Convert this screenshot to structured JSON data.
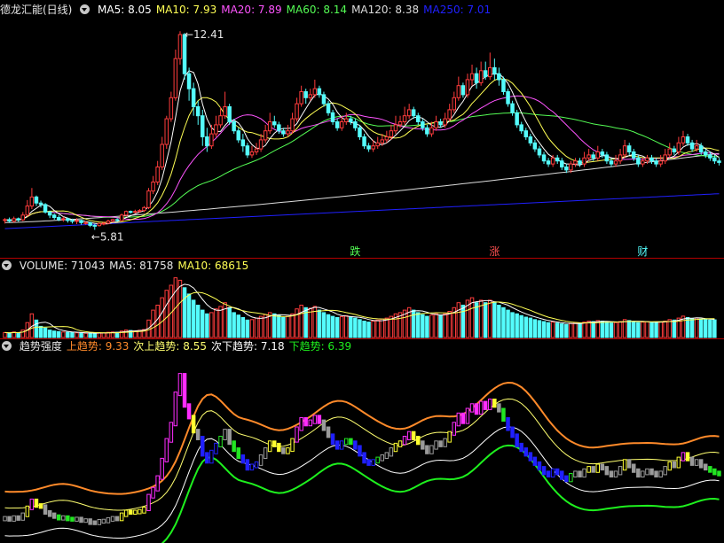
{
  "colors": {
    "up": "#ff3c3c",
    "down": "#54fcfc",
    "ma5": "#ffffff",
    "ma10": "#ffff54",
    "ma20": "#ff54ff",
    "ma60": "#54fc54",
    "ma120": "#dcdcdc",
    "ma250": "#2020ff",
    "sep": "#b40000",
    "trend_up": "#ff8a2a",
    "trend_up2": "#ffff70",
    "trend_down2": "#ffffff",
    "trend_down": "#1ef01e"
  },
  "price_panel": {
    "title": "德龙汇能(日线)",
    "legend": [
      {
        "label": "MA5: 8.05",
        "color": "#ffffff"
      },
      {
        "label": "MA10: 7.93",
        "color": "#ffff54"
      },
      {
        "label": "MA20: 7.89",
        "color": "#ff54ff"
      },
      {
        "label": "MA60: 8.14",
        "color": "#54fc54"
      },
      {
        "label": "MA120: 8.38",
        "color": "#dcdcdc"
      },
      {
        "label": "MA250: 7.01",
        "color": "#2020ff"
      }
    ],
    "high_label": "12.41",
    "low_label": "5.81",
    "event_markers": [
      {
        "text": "跌",
        "color": "#54fc54",
        "index": 78
      },
      {
        "text": "涨",
        "color": "#ff5050",
        "index": 109
      },
      {
        "text": "财",
        "color": "#54fcfc",
        "index": 142
      }
    ]
  },
  "volume_panel": {
    "legend": [
      {
        "label": "VOLUME: 71043",
        "color": "#e6e6e6"
      },
      {
        "label": "MA5: 81758",
        "color": "#e6e6e6"
      },
      {
        "label": "MA10: 68615",
        "color": "#ffff54"
      }
    ]
  },
  "trend_panel": {
    "legend": [
      {
        "label": "趋势强度",
        "color": "#e6e6e6"
      },
      {
        "label": "上趋势: 9.33",
        "color": "#ff8a2a"
      },
      {
        "label": "次上趋势: 8.55",
        "color": "#ffff70"
      },
      {
        "label": "次下趋势: 7.18",
        "color": "#ffffff"
      },
      {
        "label": "下趋势: 6.39",
        "color": "#1ef01e"
      }
    ]
  },
  "chart_data": [
    {
      "type": "candlestick",
      "title": "德龙汇能(日线)",
      "ylim": [
        5.5,
        12.8
      ],
      "candles": [
        [
          6.12,
          6.15,
          6.02,
          6.2
        ],
        [
          6.15,
          6.1,
          6.05,
          6.22
        ],
        [
          6.1,
          6.18,
          6.05,
          6.25
        ],
        [
          6.18,
          6.14,
          6.08,
          6.22
        ],
        [
          6.14,
          6.3,
          6.1,
          6.4
        ],
        [
          6.3,
          6.6,
          6.25,
          6.8
        ],
        [
          6.6,
          6.9,
          6.5,
          7.2
        ],
        [
          6.9,
          6.7,
          6.6,
          6.95
        ],
        [
          6.7,
          6.65,
          6.55,
          6.78
        ],
        [
          6.65,
          6.4,
          6.35,
          6.7
        ],
        [
          6.4,
          6.3,
          6.2,
          6.45
        ],
        [
          6.3,
          6.22,
          6.15,
          6.35
        ],
        [
          6.22,
          6.15,
          6.1,
          6.3
        ],
        [
          6.15,
          6.18,
          6.08,
          6.25
        ],
        [
          6.18,
          6.12,
          6.05,
          6.22
        ],
        [
          6.12,
          6.1,
          6.02,
          6.18
        ],
        [
          6.1,
          6.12,
          6.0,
          6.2
        ],
        [
          6.12,
          6.05,
          5.98,
          6.15
        ],
        [
          6.05,
          6.05,
          5.98,
          6.1
        ],
        [
          6.05,
          5.96,
          5.9,
          6.08
        ],
        [
          5.96,
          5.95,
          5.81,
          6.0
        ],
        [
          5.95,
          6.02,
          5.92,
          6.05
        ],
        [
          6.02,
          6.03,
          5.96,
          6.08
        ],
        [
          6.03,
          6.1,
          6.0,
          6.15
        ],
        [
          6.1,
          6.15,
          6.05,
          6.18
        ],
        [
          6.15,
          6.12,
          6.08,
          6.2
        ],
        [
          6.12,
          6.3,
          6.1,
          6.35
        ],
        [
          6.3,
          6.42,
          6.25,
          6.45
        ],
        [
          6.42,
          6.4,
          6.35,
          6.45
        ],
        [
          6.4,
          6.42,
          6.36,
          6.48
        ],
        [
          6.42,
          6.45,
          6.38,
          6.5
        ],
        [
          6.45,
          6.55,
          6.4,
          6.6
        ],
        [
          6.55,
          7.1,
          6.5,
          7.2
        ],
        [
          7.1,
          7.4,
          7.0,
          7.6
        ],
        [
          7.4,
          7.9,
          7.3,
          8.1
        ],
        [
          7.9,
          8.65,
          7.8,
          8.9
        ],
        [
          8.65,
          9.5,
          8.5,
          9.6
        ],
        [
          9.5,
          10.2,
          9.4,
          10.4
        ],
        [
          10.2,
          11.5,
          10.1,
          11.8
        ],
        [
          11.5,
          12.3,
          11.3,
          12.41
        ],
        [
          12.3,
          11.0,
          10.8,
          12.35
        ],
        [
          11.0,
          10.5,
          10.1,
          11.2
        ],
        [
          10.5,
          9.9,
          9.6,
          10.7
        ],
        [
          9.9,
          9.6,
          9.3,
          10.1
        ],
        [
          9.6,
          8.9,
          8.6,
          9.8
        ],
        [
          8.9,
          8.6,
          8.4,
          9.2
        ],
        [
          8.6,
          9.0,
          8.5,
          9.3
        ],
        [
          9.0,
          9.3,
          8.9,
          9.6
        ],
        [
          9.3,
          9.6,
          9.2,
          9.9
        ],
        [
          9.6,
          9.9,
          9.5,
          10.4
        ],
        [
          9.9,
          9.4,
          9.3,
          10.0
        ],
        [
          9.4,
          9.1,
          9.0,
          9.5
        ],
        [
          9.1,
          8.8,
          8.7,
          9.2
        ],
        [
          8.8,
          8.6,
          8.4,
          9.0
        ],
        [
          8.6,
          8.3,
          8.2,
          8.7
        ],
        [
          8.3,
          8.4,
          8.2,
          8.6
        ],
        [
          8.4,
          8.5,
          8.3,
          8.7
        ],
        [
          8.5,
          8.8,
          8.4,
          9.0
        ],
        [
          8.8,
          9.1,
          8.7,
          9.3
        ],
        [
          9.1,
          9.4,
          9.0,
          9.7
        ],
        [
          9.4,
          9.3,
          9.2,
          9.6
        ],
        [
          9.3,
          9.1,
          9.0,
          9.4
        ],
        [
          9.1,
          9.0,
          8.9,
          9.2
        ],
        [
          9.0,
          9.1,
          8.9,
          9.3
        ],
        [
          9.1,
          9.5,
          9.0,
          9.7
        ],
        [
          9.5,
          10.0,
          9.4,
          10.2
        ],
        [
          10.0,
          10.4,
          9.9,
          10.6
        ],
        [
          10.4,
          10.2,
          10.0,
          10.5
        ],
        [
          10.2,
          10.3,
          10.1,
          10.5
        ],
        [
          10.3,
          10.5,
          10.2,
          10.8
        ],
        [
          10.5,
          10.3,
          10.2,
          10.6
        ],
        [
          10.3,
          10.0,
          9.9,
          10.4
        ],
        [
          10.0,
          9.7,
          9.6,
          10.1
        ],
        [
          9.7,
          9.4,
          9.3,
          9.8
        ],
        [
          9.4,
          9.2,
          9.1,
          9.5
        ],
        [
          9.2,
          9.4,
          9.1,
          9.6
        ],
        [
          9.4,
          9.5,
          9.3,
          9.7
        ],
        [
          9.5,
          9.4,
          9.3,
          9.6
        ],
        [
          9.4,
          9.2,
          9.1,
          9.5
        ],
        [
          9.2,
          8.9,
          8.8,
          9.3
        ],
        [
          8.9,
          8.6,
          8.5,
          9.0
        ],
        [
          8.6,
          8.5,
          8.4,
          8.7
        ],
        [
          8.5,
          8.6,
          8.4,
          8.8
        ],
        [
          8.6,
          8.7,
          8.5,
          8.9
        ],
        [
          8.7,
          8.8,
          8.6,
          9.0
        ],
        [
          8.8,
          8.9,
          8.7,
          9.1
        ],
        [
          8.9,
          9.1,
          8.8,
          9.3
        ],
        [
          9.1,
          9.3,
          9.0,
          9.6
        ],
        [
          9.3,
          9.4,
          9.2,
          9.6
        ],
        [
          9.4,
          9.6,
          9.3,
          9.9
        ],
        [
          9.6,
          9.8,
          9.5,
          10.0
        ],
        [
          9.8,
          9.6,
          9.5,
          9.9
        ],
        [
          9.6,
          9.4,
          9.3,
          9.7
        ],
        [
          9.4,
          9.2,
          9.1,
          9.5
        ],
        [
          9.2,
          9.0,
          8.9,
          9.3
        ],
        [
          9.0,
          9.2,
          8.9,
          9.4
        ],
        [
          9.2,
          9.4,
          9.1,
          9.6
        ],
        [
          9.4,
          9.3,
          9.2,
          9.5
        ],
        [
          9.3,
          9.5,
          9.2,
          9.7
        ],
        [
          9.5,
          9.8,
          9.4,
          10.0
        ],
        [
          9.8,
          10.2,
          9.7,
          10.4
        ],
        [
          10.2,
          10.6,
          10.1,
          10.9
        ],
        [
          10.6,
          10.3,
          10.2,
          10.7
        ],
        [
          10.3,
          10.8,
          10.2,
          11.0
        ],
        [
          10.8,
          11.0,
          10.6,
          11.3
        ],
        [
          11.0,
          10.7,
          10.5,
          11.2
        ],
        [
          10.7,
          11.1,
          10.6,
          11.4
        ],
        [
          11.1,
          10.9,
          10.8,
          11.4
        ],
        [
          10.9,
          11.2,
          10.8,
          11.7
        ],
        [
          11.2,
          11.0,
          10.8,
          11.5
        ],
        [
          11.0,
          10.8,
          10.6,
          11.2
        ],
        [
          10.8,
          10.4,
          10.3,
          10.9
        ],
        [
          10.4,
          10.0,
          9.9,
          10.5
        ],
        [
          10.0,
          9.7,
          9.6,
          10.1
        ],
        [
          9.7,
          9.3,
          9.2,
          9.8
        ],
        [
          9.3,
          9.1,
          9.0,
          9.4
        ],
        [
          9.1,
          8.9,
          8.8,
          9.2
        ],
        [
          8.9,
          8.7,
          8.6,
          9.0
        ],
        [
          8.7,
          8.5,
          8.4,
          8.8
        ],
        [
          8.5,
          8.3,
          8.2,
          8.6
        ],
        [
          8.3,
          8.1,
          8.0,
          8.4
        ],
        [
          8.1,
          8.0,
          7.9,
          8.2
        ],
        [
          8.0,
          8.2,
          7.9,
          8.3
        ],
        [
          8.2,
          8.1,
          8.0,
          8.3
        ],
        [
          8.1,
          7.9,
          7.8,
          8.2
        ],
        [
          7.9,
          7.8,
          7.7,
          8.0
        ],
        [
          7.8,
          8.0,
          7.7,
          8.1
        ],
        [
          8.0,
          8.1,
          7.9,
          8.2
        ],
        [
          8.1,
          8.0,
          7.9,
          8.2
        ],
        [
          8.0,
          8.2,
          7.9,
          8.4
        ],
        [
          8.2,
          8.3,
          8.1,
          8.5
        ],
        [
          8.3,
          8.2,
          8.1,
          8.4
        ],
        [
          8.2,
          8.4,
          8.1,
          8.6
        ],
        [
          8.4,
          8.3,
          8.2,
          8.5
        ],
        [
          8.3,
          8.1,
          8.0,
          8.4
        ],
        [
          8.1,
          8.0,
          7.9,
          8.2
        ],
        [
          8.0,
          8.1,
          7.9,
          8.3
        ],
        [
          8.1,
          8.3,
          8.0,
          8.5
        ],
        [
          8.3,
          8.6,
          8.2,
          8.8
        ],
        [
          8.6,
          8.4,
          8.3,
          8.7
        ],
        [
          8.4,
          8.2,
          8.1,
          8.5
        ],
        [
          8.2,
          8.0,
          7.9,
          8.3
        ],
        [
          8.0,
          8.1,
          7.9,
          8.2
        ],
        [
          8.1,
          8.2,
          8.0,
          8.3
        ],
        [
          8.2,
          8.1,
          8.0,
          8.3
        ],
        [
          8.1,
          8.0,
          7.9,
          8.2
        ],
        [
          8.0,
          8.1,
          7.9,
          8.3
        ],
        [
          8.1,
          8.3,
          8.0,
          8.5
        ],
        [
          8.3,
          8.5,
          8.2,
          8.7
        ],
        [
          8.5,
          8.4,
          8.3,
          8.6
        ],
        [
          8.4,
          8.7,
          8.3,
          8.9
        ],
        [
          8.7,
          8.9,
          8.6,
          9.1
        ],
        [
          8.9,
          8.7,
          8.6,
          9.0
        ],
        [
          8.7,
          8.5,
          8.4,
          8.8
        ],
        [
          8.5,
          8.6,
          8.4,
          8.8
        ],
        [
          8.6,
          8.4,
          8.3,
          8.7
        ],
        [
          8.4,
          8.3,
          8.2,
          8.5
        ],
        [
          8.3,
          8.2,
          8.1,
          8.4
        ],
        [
          8.2,
          8.1,
          8.0,
          8.3
        ],
        [
          8.1,
          8.05,
          7.95,
          8.2
        ]
      ]
    },
    {
      "type": "bar",
      "title": "VOLUME",
      "ylim": [
        0,
        260000
      ],
      "values": [
        20000,
        18000,
        22000,
        19000,
        30000,
        60000,
        95000,
        70000,
        45000,
        38000,
        30000,
        26000,
        24000,
        22000,
        21000,
        20000,
        19000,
        18000,
        17000,
        16000,
        18000,
        20000,
        19000,
        21000,
        22000,
        21000,
        26000,
        30000,
        28000,
        27000,
        29000,
        32000,
        70000,
        110000,
        130000,
        160000,
        190000,
        210000,
        240000,
        230000,
        200000,
        175000,
        150000,
        130000,
        110000,
        95000,
        100000,
        115000,
        125000,
        140000,
        120000,
        100000,
        90000,
        80000,
        70000,
        72000,
        78000,
        85000,
        92000,
        100000,
        95000,
        88000,
        80000,
        85000,
        95000,
        115000,
        130000,
        120000,
        118000,
        125000,
        110000,
        100000,
        92000,
        85000,
        80000,
        84000,
        88000,
        84000,
        78000,
        72000,
        66000,
        62000,
        66000,
        70000,
        74000,
        78000,
        85000,
        95000,
        100000,
        110000,
        120000,
        110000,
        100000,
        92000,
        85000,
        90000,
        95000,
        90000,
        95000,
        105000,
        120000,
        140000,
        130000,
        150000,
        160000,
        140000,
        150000,
        140000,
        150000,
        140000,
        130000,
        120000,
        110000,
        100000,
        95000,
        88000,
        82000,
        78000,
        72000,
        68000,
        64000,
        60000,
        62000,
        58000,
        55000,
        52000,
        56000,
        60000,
        58000,
        62000,
        66000,
        64000,
        68000,
        66000,
        62000,
        58000,
        60000,
        64000,
        72000,
        68000,
        64000,
        60000,
        62000,
        64000,
        62000,
        60000,
        62000,
        66000,
        72000,
        70000,
        78000,
        86000,
        80000,
        75000,
        78000,
        74000,
        72000,
        70000,
        71043
      ],
      "ma5_last": 81758,
      "ma10_last": 68615
    },
    {
      "type": "line",
      "title": "趋势强度",
      "series_last": [
        {
          "name": "上趋势",
          "value": 9.33
        },
        {
          "name": "次上趋势",
          "value": 8.55
        },
        {
          "name": "次下趋势",
          "value": 7.18
        },
        {
          "name": "下趋势",
          "value": 6.39
        }
      ]
    }
  ]
}
